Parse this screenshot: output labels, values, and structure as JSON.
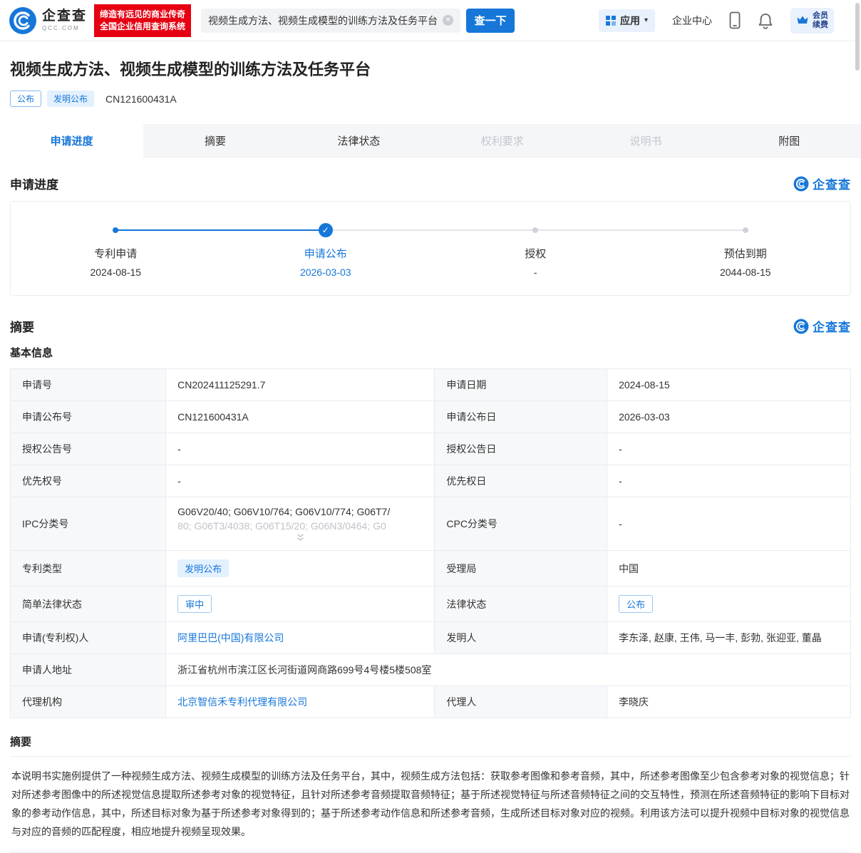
{
  "icons": {
    "check": "✓",
    "caret": "▾",
    "clear": "✕"
  },
  "header": {
    "logo": {
      "name": "企查查",
      "sub": "QCC.COM"
    },
    "slogan": {
      "line1": "缔造有远见的商业传奇",
      "line2": "全国企业信用查询系统"
    },
    "search": {
      "value": "视频生成方法、视频生成模型的训练方法及任务平台",
      "button": "查一下"
    },
    "nav": {
      "apps": "应用",
      "enterprise_center": "企业中心",
      "vip_line1": "会员",
      "vip_line2": "续费"
    }
  },
  "patent": {
    "title": "视频生成方法、视频生成模型的训练方法及任务平台",
    "tag_public": "公布",
    "tag_invention": "发明公布",
    "number": "CN121600431A"
  },
  "tabs": [
    {
      "label": "申请进度"
    },
    {
      "label": "摘要"
    },
    {
      "label": "法律状态"
    },
    {
      "label": "权利要求"
    },
    {
      "label": "说明书"
    },
    {
      "label": "附图"
    }
  ],
  "watermark": "企查查",
  "progress": {
    "title": "申请进度",
    "steps": [
      {
        "label": "专利申请",
        "date": "2024-08-15"
      },
      {
        "label": "申请公布",
        "date": "2026-03-03"
      },
      {
        "label": "授权",
        "date": "-"
      },
      {
        "label": "预估到期",
        "date": "2044-08-15"
      }
    ]
  },
  "summary": {
    "title": "摘要",
    "basic_info": "基本信息",
    "rows": [
      {
        "l1": "申请号",
        "v1": "CN202411125291.7",
        "l2": "申请日期",
        "v2": "2024-08-15"
      },
      {
        "l1": "申请公布号",
        "v1": "CN121600431A",
        "l2": "申请公布日",
        "v2": "2026-03-03"
      },
      {
        "l1": "授权公告号",
        "v1": "-",
        "l2": "授权公告日",
        "v2": "-"
      },
      {
        "l1": "优先权号",
        "v1": "-",
        "l2": "优先权日",
        "v2": "-"
      },
      {
        "l1": "IPC分类号",
        "v1a": "G06V20/40; G06V10/764; G06V10/774; G06T7/",
        "v1b": "80; G06T3/4038; G06T15/20; G06N3/0464; G0",
        "l2": "CPC分类号",
        "v2": "-"
      },
      {
        "l1": "专利类型",
        "v1": "发明公布",
        "l2": "受理局",
        "v2": "中国"
      },
      {
        "l1": "简单法律状态",
        "v1": "审中",
        "l2": "法律状态",
        "v2": "公布"
      },
      {
        "l1": "申请(专利权)人",
        "v1": "阿里巴巴(中国)有限公司",
        "l2": "发明人",
        "v2": "李东泽, 赵康, 王伟, 马一丰, 彭勃, 张迎亚, 董晶"
      },
      {
        "l1": "申请人地址",
        "v1": "浙江省杭州市滨江区长河街道网商路699号4号楼5楼508室"
      },
      {
        "l1": "代理机构",
        "v1": "北京智信禾专利代理有限公司",
        "l2": "代理人",
        "v2": "李晓庆"
      }
    ],
    "abstract_title": "摘要",
    "abstract": "本说明书实施例提供了一种视频生成方法、视频生成模型的训练方法及任务平台，其中，视频生成方法包括：获取参考图像和参考音频，其中，所述参考图像至少包含参考对象的视觉信息；针对所述参考图像中的所述视觉信息提取所述参考对象的视觉特征，且针对所述参考音频提取音频特征；基于所述视觉特征与所述音频特征之间的交互特性，预测在所述音频特征的影响下目标对象的参考动作信息，其中，所述目标对象为基于所述参考对象得到的；基于所述参考动作信息和所述参考音频，生成所述目标对象对应的视频。利用该方法可以提升视频中目标对象的视觉信息与对应的音频的匹配程度，相应地提升视频呈现效果。"
  }
}
